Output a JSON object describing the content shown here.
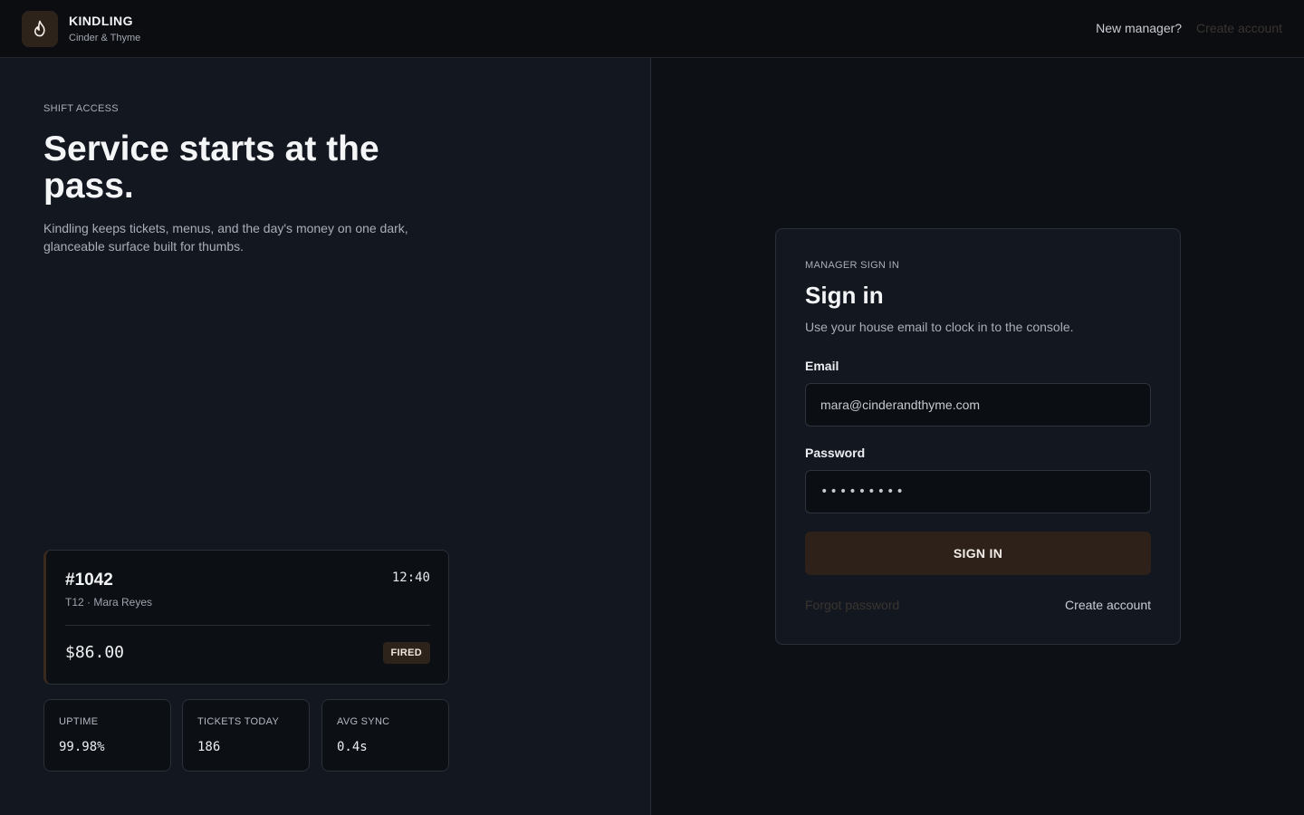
{
  "header": {
    "logo_icon": "flame-icon",
    "brand_name": "KINDLING",
    "brand_sub": "Cinder & Thyme",
    "new_manager_text": "New manager?",
    "create_account_link": "Create account"
  },
  "hero": {
    "eyebrow": "SHIFT ACCESS",
    "title": "Service starts at the pass.",
    "description": "Kindling keeps tickets, menus, and the day's money on one dark, glanceable surface built for thumbs."
  },
  "ticket": {
    "id": "#1042",
    "time": "12:40",
    "meta": "T12 · Mara Reyes",
    "amount": "$86.00",
    "status": "FIRED"
  },
  "stats": [
    {
      "label": "UPTIME",
      "value": "99.98%"
    },
    {
      "label": "TICKETS TODAY",
      "value": "186"
    },
    {
      "label": "AVG SYNC",
      "value": "0.4s"
    }
  ],
  "signin": {
    "eyebrow": "MANAGER SIGN IN",
    "title": "Sign in",
    "description": "Use your house email to clock in to the console.",
    "email_label": "Email",
    "email_value": "mara@cinderandthyme.com",
    "password_label": "Password",
    "password_value": "•••••••••",
    "button_label": "SIGN IN",
    "forgot_link": "Forgot password",
    "create_link": "Create account"
  },
  "colors": {
    "accent": "#2e231b",
    "background": "#0e1116",
    "panel": "#131720"
  }
}
